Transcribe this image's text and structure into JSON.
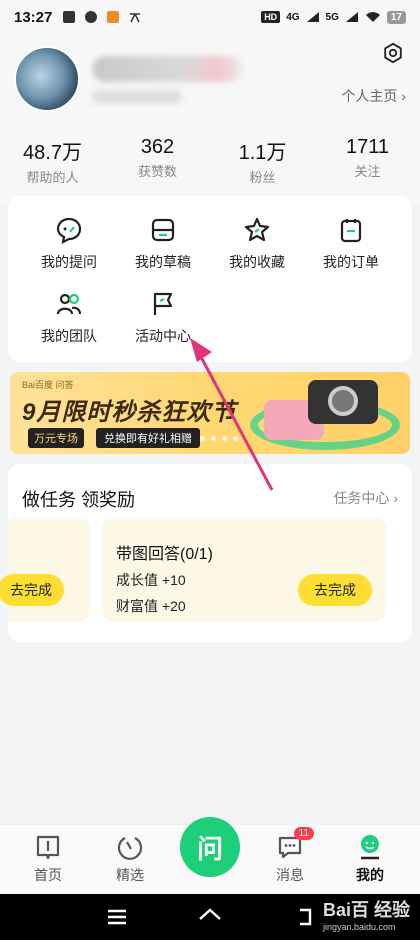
{
  "status_bar": {
    "time": "13:27",
    "network1": "4G",
    "network2": "5G",
    "battery": "17"
  },
  "profile": {
    "homepage_link": "个人主页 ›"
  },
  "stats": [
    {
      "value": "48.7万",
      "label": "帮助的人"
    },
    {
      "value": "362",
      "label": "获赞数"
    },
    {
      "value": "1.1万",
      "label": "粉丝"
    },
    {
      "value": "1711",
      "label": "关注"
    }
  ],
  "menu": [
    {
      "label": "我的提问",
      "icon": "question-bubble-icon"
    },
    {
      "label": "我的草稿",
      "icon": "draft-box-icon"
    },
    {
      "label": "我的收藏",
      "icon": "star-icon"
    },
    {
      "label": "我的订单",
      "icon": "order-icon"
    },
    {
      "label": "我的团队",
      "icon": "team-icon"
    },
    {
      "label": "活动中心",
      "icon": "flag-icon"
    }
  ],
  "banner": {
    "logo": "Bai百度 问答",
    "title": "9月限时秒杀狂欢节",
    "tag": "万元专场",
    "tag_text": "兑换即有好礼相赠"
  },
  "tasks": {
    "title": "做任务 领奖励",
    "center_link": "任务中心 ›",
    "left_button": "去完成",
    "main": {
      "title": "带图回答(0/1)",
      "reward1": "成长值 +10",
      "reward2": "财富值 +20",
      "button": "去完成"
    }
  },
  "tabbar": {
    "tabs": [
      {
        "label": "首页",
        "icon": "book-icon"
      },
      {
        "label": "精选",
        "icon": "featured-icon"
      },
      {
        "label": "问",
        "icon": "ask-icon"
      },
      {
        "label": "消息",
        "icon": "message-icon",
        "badge": "11"
      },
      {
        "label": "我的",
        "icon": "profile-icon"
      }
    ]
  },
  "watermark": {
    "brand": "Bai百 经验",
    "url": "jingyan.baidu.com"
  },
  "colors": {
    "accent_green": "#1ecf7a",
    "button_yellow": "#ffde33",
    "annotation_arrow": "#e0337a"
  }
}
